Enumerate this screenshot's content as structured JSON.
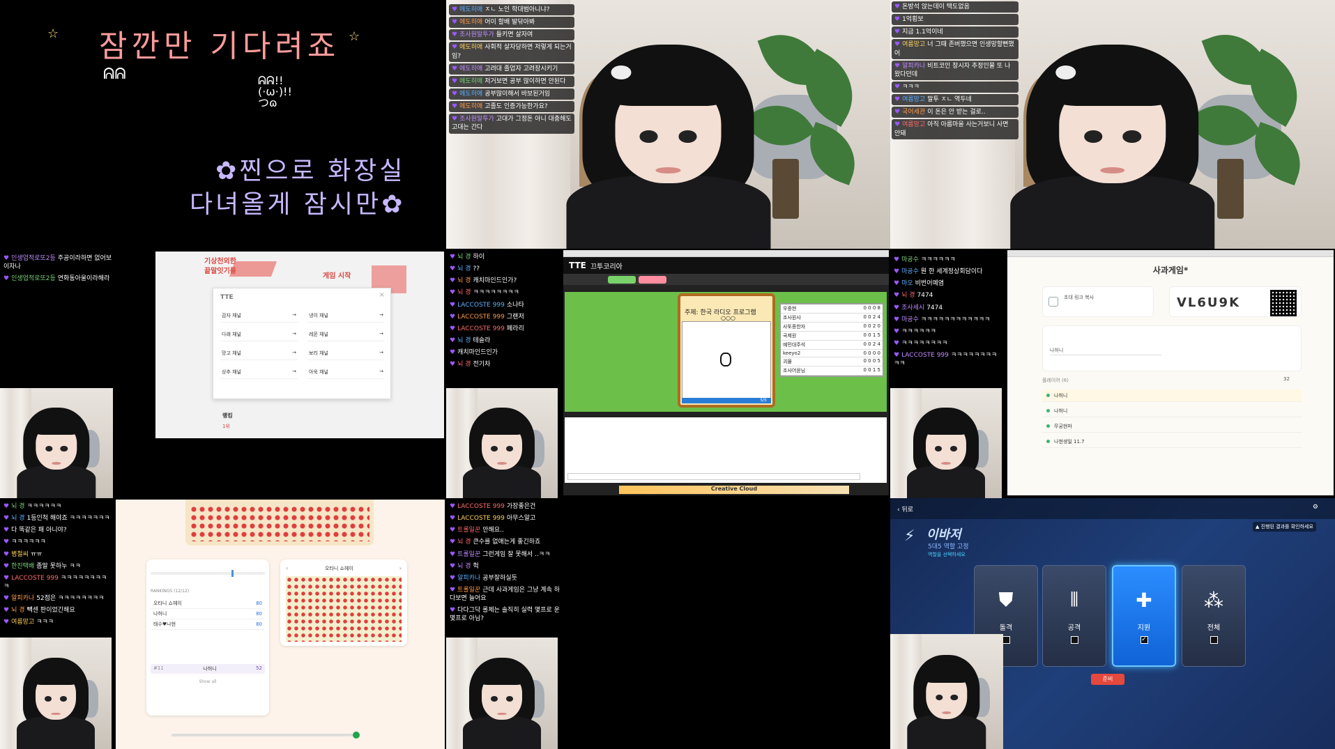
{
  "cell1": {
    "title": "잠깐만 기다려죠",
    "doodle_left": "ᕱᕱ",
    "doodle_right": "ᕱᕱ!!\n(·ω·)!!\nつɷ",
    "sub_line1": "✿찐으로 화장실",
    "sub_line2": "다녀올게 잠시만✿"
  },
  "cell2": {
    "chat": [
      {
        "name": "에도히애",
        "text": "ㅈㄴ 노인 학대범아니냐?"
      },
      {
        "name": "에도히애",
        "text": "어이 할배 발닦아봐"
      },
      {
        "name": "조사원말투가",
        "text": "들키면 살자여"
      },
      {
        "name": "에도히애",
        "text": "사회적 살자당하면 저렇게 되는거임?"
      },
      {
        "name": "에도히애",
        "text": "고려대 졸업자 고려장시키기"
      },
      {
        "name": "에도히애",
        "text": "저거보면 공부 많이하면 안된다"
      },
      {
        "name": "에도히애",
        "text": "공부많이해서 바보된거임"
      },
      {
        "name": "에도히애",
        "text": "고졸도 인증가능한가요?"
      },
      {
        "name": "조사원말투가",
        "text": "고대가 그정돈 아니 대충해도 고대는 간다"
      }
    ]
  },
  "cell3": {
    "chat": [
      {
        "name": "",
        "text": "돈방석 앉는데이 택도없음"
      },
      {
        "name": "",
        "text": "1억횡보"
      },
      {
        "name": "",
        "text": "지금 1.1억이네"
      },
      {
        "name": "여름망고",
        "text": "너 그때 존버했으면 인생망할뻔했어"
      },
      {
        "name": "알피카나",
        "text": "비트코인 창시자 추정인물 또 나왔다던데"
      },
      {
        "name": "",
        "text": "ㅋㅋㅋ"
      },
      {
        "name": "여름망고",
        "text": "말투 ㅈㄴ 역두네"
      },
      {
        "name": "국어세관",
        "text": "이 돈은 안 받는 걸로.."
      },
      {
        "name": "여름망고",
        "text": "아직 아름마을 사는거보니 사면 안돼"
      }
    ]
  },
  "cell4": {
    "chat": [
      {
        "name": "인생업적로또2등",
        "text": "주공이라하면 없어보이자나"
      },
      {
        "name": "인생업적로또2등",
        "text": "연화동아울이라해라"
      }
    ],
    "site_logo": "TTE",
    "banner_left": "기상천외한\n끝말잇기를",
    "banner_right": "게임 시작",
    "channels": [
      {
        "name": "감자 채널"
      },
      {
        "name": "냉이 채널"
      },
      {
        "name": "다래 채널"
      },
      {
        "name": "레몬 채널"
      },
      {
        "name": "망고 채널"
      },
      {
        "name": "보리 채널"
      },
      {
        "name": "상추 채널"
      },
      {
        "name": "아욱 채널"
      }
    ],
    "ranking_label": "랭킹",
    "rank_row": "1위"
  },
  "cell5": {
    "chat": [
      {
        "name": "뇌 경",
        "text": "하이"
      },
      {
        "name": "뇌 경",
        "text": "??"
      },
      {
        "name": "뇌 경",
        "text": "캐치마인드인가?"
      },
      {
        "name": "뇌 경",
        "text": "ㅋㅋㅋㅋㅋㅋㅋㅋ"
      },
      {
        "name": "LACCOSTE 999",
        "text": "소나타"
      },
      {
        "name": "LACCOSTE 999",
        "text": "그랜저"
      },
      {
        "name": "LACCOSTE 999",
        "text": "페라리"
      },
      {
        "name": "뇌 경",
        "text": "테슬라"
      },
      {
        "name": "",
        "text": "캐치마인드인가"
      },
      {
        "name": "뇌 경",
        "text": "전기차"
      }
    ],
    "game_name": "끄투코리아",
    "topic": "주제: 한국 라디오 프로그램",
    "topic_hint": "○○○",
    "timer": "5/5",
    "players": [
      "우중현",
      "조사원사",
      "사토종한자",
      "국제원",
      "예민대주석",
      "keeyo2",
      "괴물",
      "조사어윤님"
    ],
    "scores": [
      "0 0 0 8",
      "0 0 2 4",
      "0 0 2 0",
      "0 0 1 5",
      "0 0 2 4",
      "0 0 0 0",
      "0 0 0 5",
      "0 0 1 5"
    ],
    "footer_text": "Creative Cloud"
  },
  "cell6": {
    "chat": [
      {
        "name": "마공수",
        "text": "ㅋㅋㅋㅋㅋㅋ"
      },
      {
        "name": "마공수",
        "text": "뭔 한 세계정상회담이다"
      },
      {
        "name": "마오",
        "text": "비번어예염"
      },
      {
        "name": "뇌 경",
        "text": "7474"
      },
      {
        "name": "조사세시",
        "text": "7474"
      },
      {
        "name": "마공수",
        "text": "ㅋㅋㅋㅋㅋㅋㅋㅋㅋㅋㅋㅋ"
      },
      {
        "name": "",
        "text": "ㅋㅋㅋㅋㅋㅋ"
      },
      {
        "name": "",
        "text": "ㅋㅋㅋㅋㅋㅋㅋㅋ"
      },
      {
        "name": "LACCOSTE 999",
        "text": "ㅋㅋㅋㅋㅋㅋㅋㅋㅋㅋ"
      }
    ],
    "lobby_title": "사과게임*",
    "invite_label": "초대 링크 복사",
    "room_code": "VL6U9K",
    "nickname_value": "나허니",
    "players_header": "플레이어 (6)",
    "max_players": "32",
    "player_list": [
      "나허니",
      "나허니",
      "무궁현마",
      "나현생일 11.7"
    ]
  },
  "cell7": {
    "chat": [
      {
        "name": "뇌 경",
        "text": "ㅋㅋㅋㅋㅋㅋ"
      },
      {
        "name": "뇌 경",
        "text": "1등인척 해야죠 ㅋㅋㅋㅋㅋㅋㅋ"
      },
      {
        "name": "",
        "text": "다 똑같은 패 아니야?"
      },
      {
        "name": "",
        "text": "ㅋㅋㅋㅋㅋㅋ"
      },
      {
        "name": "병철씨",
        "text": "ㅠㅠ"
      },
      {
        "name": "한진택배",
        "text": "좀말 못하누 ㅋㅋ"
      },
      {
        "name": "LACCOSTE 999",
        "text": "ㅋㅋㅋㅋㅋㅋㅋㅋㅋ"
      },
      {
        "name": "알피카나",
        "text": "52점은 ㅋㅋㅋㅋㅋㅋㅋㅋ"
      },
      {
        "name": "뇌 경",
        "text": "빽센 판이었긴해요"
      },
      {
        "name": "여름망고",
        "text": "ㅋㅋㅋ"
      }
    ],
    "rankings_header": "RANKINGS (12/12)",
    "rank_rows": [
      {
        "name": "오타니 쇼헤이",
        "score": "80"
      },
      {
        "name": "나허니",
        "score": "80"
      },
      {
        "name": "태수♥나현",
        "score": "80"
      }
    ],
    "my_rank": {
      "pos": "#11",
      "name": "나허니",
      "score": "52"
    },
    "show_all": "Show all",
    "viewing_player": "오타니 쇼헤이"
  },
  "cell8": {
    "chat": [
      {
        "name": "LACCOSTE 999",
        "text": "가장좋은건"
      },
      {
        "name": "LACCOSTE 999",
        "text": "아무스알고"
      },
      {
        "name": "트롤일꾼",
        "text": "안해요.."
      },
      {
        "name": "뇌 경",
        "text": "큰수를 없애는게 좋긴하죠"
      },
      {
        "name": "트롤일꾼",
        "text": "그런게임 잘 못해서 ..ㅋㅋ"
      },
      {
        "name": "뇌 경",
        "text": "헉"
      },
      {
        "name": "알피카나",
        "text": "공부잘하실듯"
      },
      {
        "name": "트롤일꾼",
        "text": "근데 사과게임은 그냥 계속 하다보면 늘어요"
      },
      {
        "name": "",
        "text": "다다그닥 롤체는 솔직히 실력 몇프로 운몇프로 아님?"
      }
    ]
  },
  "cell9": {
    "back_label": "뒤로",
    "game_title": "이바저",
    "game_subtitle": "5대5 역할 고정",
    "hint": "역할을 선택하세요",
    "notice": "▲ 진행된 결과를 확인하세요",
    "roles": [
      {
        "label": "돌격",
        "icon": "shield-icon",
        "selected": false
      },
      {
        "label": "공격",
        "icon": "bullets-icon",
        "selected": false
      },
      {
        "label": "지원",
        "icon": "plus-icon",
        "selected": true
      },
      {
        "label": "전체",
        "icon": "triad-icon",
        "selected": false
      }
    ],
    "ready_label": "준비"
  }
}
